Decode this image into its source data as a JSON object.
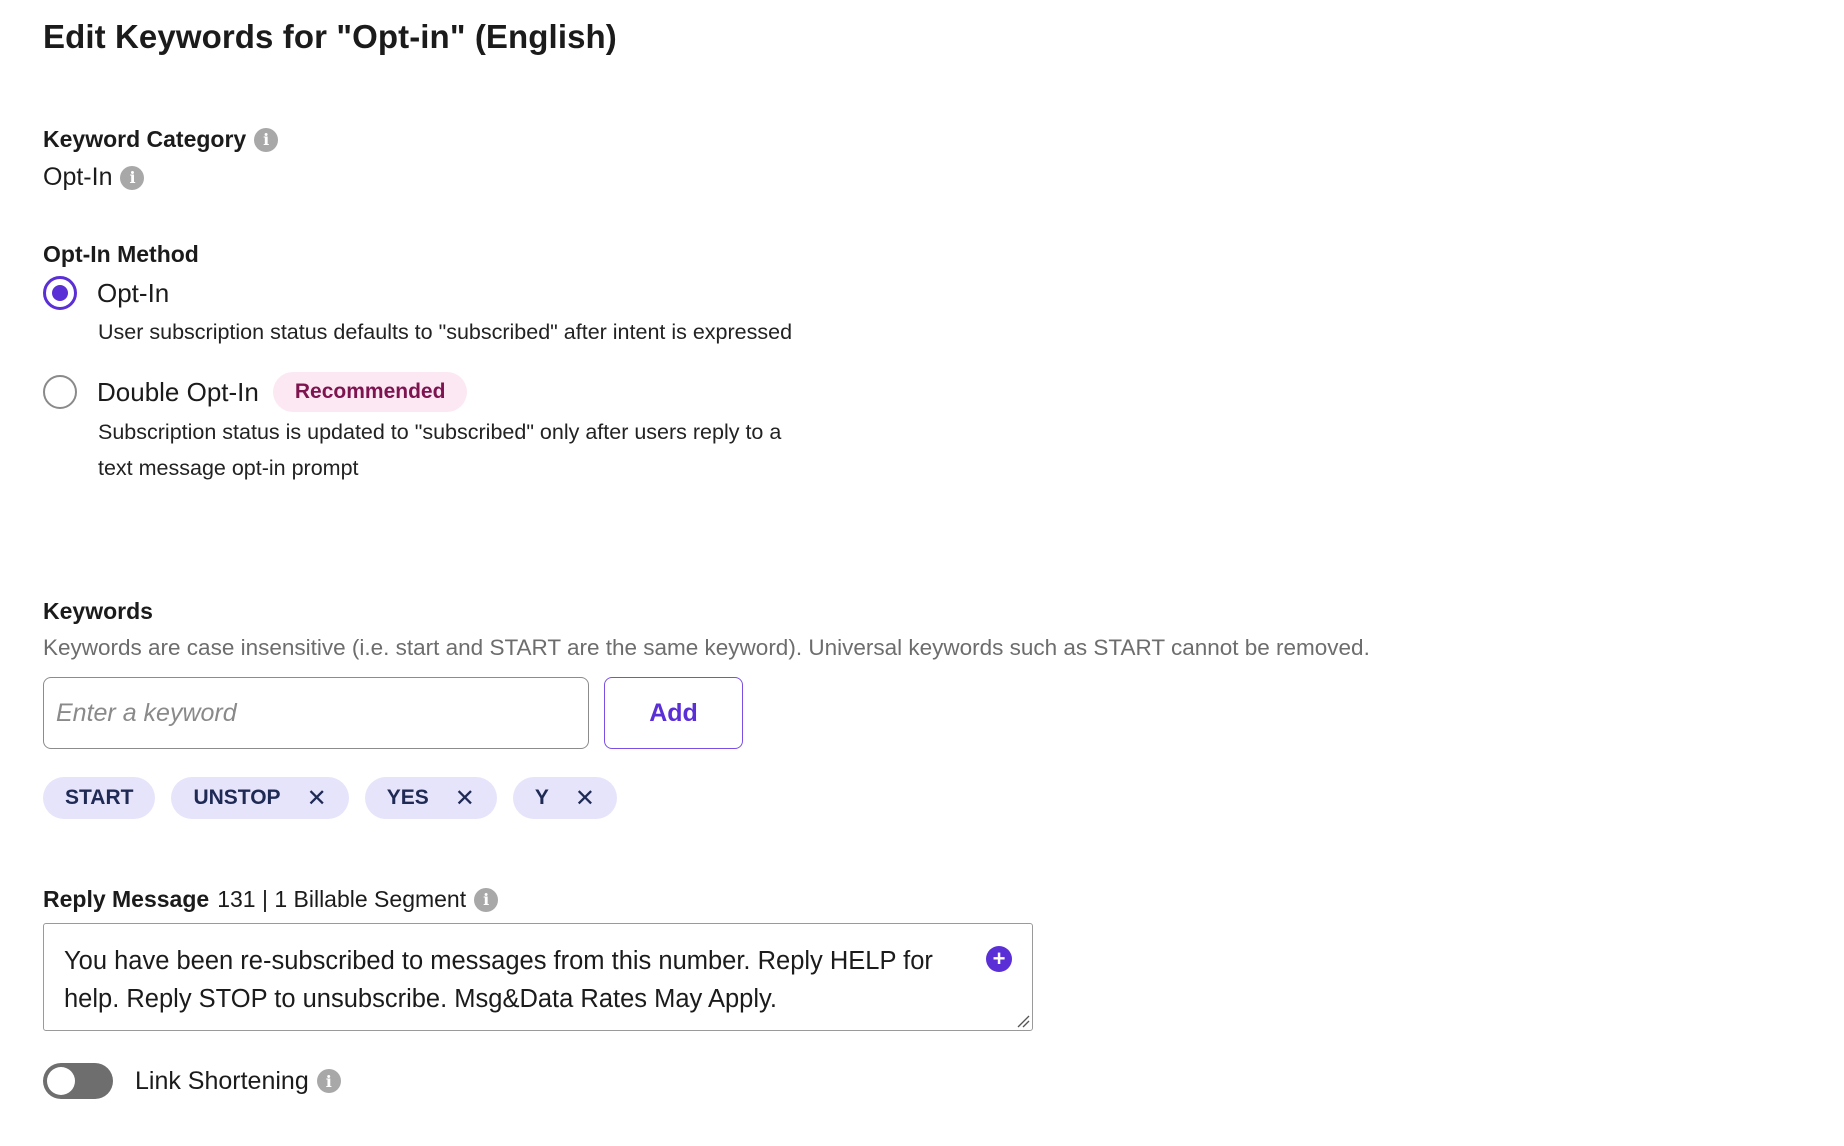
{
  "page": {
    "title": "Edit Keywords for \"Opt-in\" (English)"
  },
  "keyword_category": {
    "label": "Keyword Category",
    "value": "Opt-In"
  },
  "opt_in_method": {
    "label": "Opt-In Method",
    "options": [
      {
        "label": "Opt-In",
        "description": "User subscription status defaults to \"subscribed\" after intent is expressed",
        "selected": true
      },
      {
        "label": "Double Opt-In",
        "badge": "Recommended",
        "description_line1": "Subscription status is updated to \"subscribed\" only after users reply to a",
        "description_line2": "text message opt-in prompt",
        "selected": false
      }
    ]
  },
  "keywords": {
    "label": "Keywords",
    "help": "Keywords are case insensitive (i.e. start and START are the same keyword). Universal keywords such as START cannot be removed.",
    "input_placeholder": "Enter a keyword",
    "add_label": "Add",
    "chips": [
      {
        "text": "START",
        "removable": false
      },
      {
        "text": "UNSTOP",
        "removable": true
      },
      {
        "text": "YES",
        "removable": true
      },
      {
        "text": "Y",
        "removable": true
      }
    ],
    "remove_glyph": "✕"
  },
  "reply_message": {
    "label": "Reply Message",
    "meta": "131 | 1 Billable Segment",
    "text": "You have been re-subscribed to messages from this number. Reply HELP for help. Reply STOP to unsubscribe. Msg&Data Rates May Apply."
  },
  "link_shortening": {
    "label": "Link Shortening",
    "enabled": false
  },
  "colors": {
    "accent": "#5b2fd6",
    "chip_bg": "#e6e4fb",
    "badge_bg": "#fce8f3",
    "badge_text": "#7d1450"
  },
  "icons": {
    "info": "info-icon",
    "plus": "plus-circle-icon",
    "remove": "close-icon"
  }
}
